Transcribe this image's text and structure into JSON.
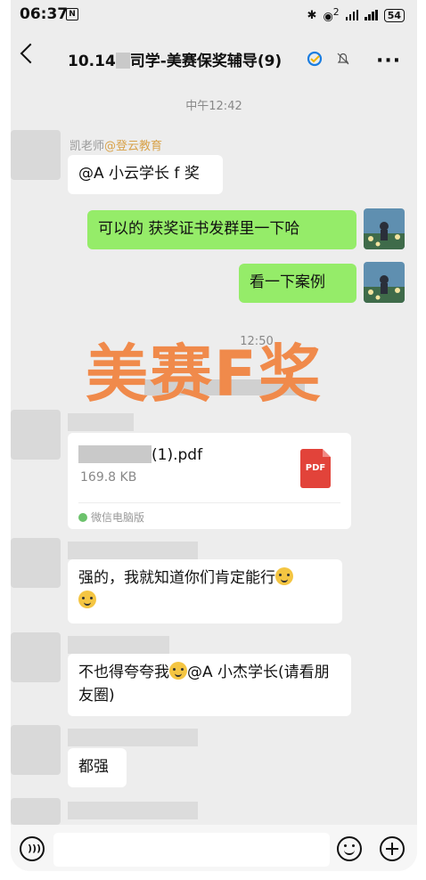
{
  "status_bar": {
    "time": "06:37",
    "nfc": "N",
    "network": "2",
    "battery": "54"
  },
  "header": {
    "title_prefix": "10.14",
    "title_suffix": "司学-美赛保奖辅导(9)"
  },
  "chat": {
    "timestamp": "中午12:42",
    "messages": [
      {
        "id": "m1",
        "side": "left",
        "sender": "凯老师",
        "org": "@登云教育",
        "text": "@A 小云学长 f 奖"
      },
      {
        "id": "m2",
        "side": "right",
        "text": "可以的 获奖证书发群里一下哈"
      },
      {
        "id": "m3",
        "side": "right",
        "text": "看一下案例"
      },
      {
        "id": "m4",
        "side": "left",
        "type": "file",
        "file_suffix": "(1).pdf",
        "file_size": "169.8 KB",
        "file_icon_label": "PDF",
        "source": "微信电脑版"
      },
      {
        "id": "m5",
        "side": "left",
        "text": "强的，我就知道你们肯定能行"
      },
      {
        "id": "m6",
        "side": "left",
        "text_a": "不也得夸夸我",
        "text_b": "@A 小杰学长(请看朋友圈)"
      },
      {
        "id": "m7",
        "side": "left",
        "text": "都强"
      }
    ]
  },
  "overlay": {
    "watermark": "美赛F奖",
    "partial_time": "12:50"
  },
  "input_bar": {
    "placeholder": ""
  },
  "colors": {
    "chat_bg": "#ededed",
    "bubble_green": "#95ec69",
    "bubble_white": "#ffffff",
    "watermark": "#f08a4b",
    "org_tag": "#d8a24a",
    "pdf_red": "#e2433a"
  }
}
